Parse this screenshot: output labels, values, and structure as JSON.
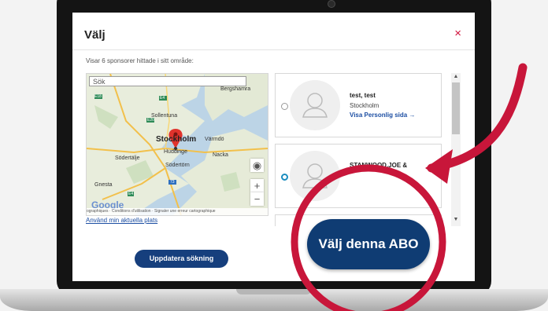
{
  "dialog": {
    "title": "Välj",
    "close_icon": "×",
    "result_text": "Visar 6 sponsorer hittade i sitt område:"
  },
  "map": {
    "search_placeholder": "Sök",
    "labels": [
      "Bergshamra",
      "Sollentuna",
      "Stockholm",
      "Värmdö",
      "Huddinge",
      "Södertälje",
      "Södertörn",
      "Gnesta",
      "Nacka"
    ],
    "road_labels": [
      "E18",
      "E4",
      "E20",
      "73",
      "E4"
    ],
    "footer": "ographiques · Conditions d'utilisation · Signaler une erreur cartographique",
    "google_label": "Google",
    "zoom_in": "+",
    "zoom_out": "−",
    "location_icon": "◉"
  },
  "use_location_link": "Använd min aktuella plats",
  "sponsors": [
    {
      "name": "test, test",
      "city": "Stockholm",
      "link": "Visa Personlig sida →",
      "selected": false
    },
    {
      "name": "STANWOOD,JOE &",
      "city": "",
      "link": "",
      "selected": true
    }
  ],
  "scroll": {
    "up": "▲",
    "down": "▼"
  },
  "buttons": {
    "update": "Uppdatera sökning",
    "choose": "Välj denna ABO"
  },
  "colors": {
    "accent_red": "#d0103a",
    "brand_blue": "#163f7d",
    "link_blue": "#1d4fa3"
  }
}
